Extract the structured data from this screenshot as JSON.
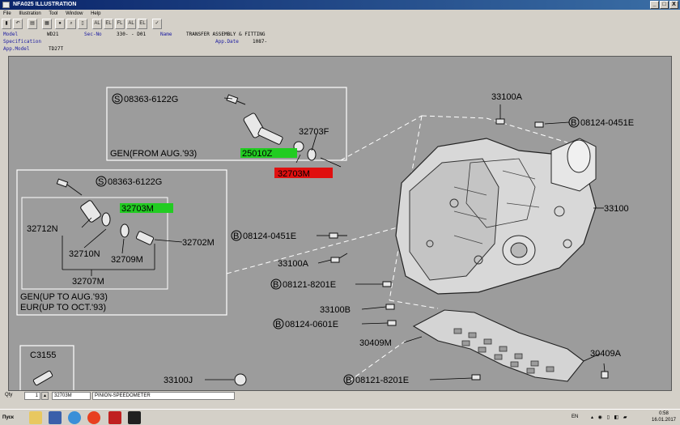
{
  "window": {
    "title": "NFA025 ILLUSTRATION",
    "min": "_",
    "max": "□",
    "close": "X"
  },
  "menu": [
    "File",
    "Illustration",
    "Tool",
    "Window",
    "Help"
  ],
  "toolbar": {
    "buttons": [
      "book-icon",
      "undo-icon",
      "print-icon",
      "save-icon",
      "circle-icon",
      "search-icon",
      "page-icon",
      "AL",
      "EL",
      "FL",
      "AL",
      "EL",
      "check-icon"
    ]
  },
  "info": {
    "model_label": "Model",
    "model": "WD21",
    "secno_label": "Sec-No",
    "secno": "330-  - D01",
    "name_label": "Name",
    "name": "TRANSFER ASSEMBLY & FITTING",
    "spec_label": "Specification",
    "appdate_label": "App.Date",
    "appdate": "1087-",
    "appmodel_label": "App.Model",
    "appmodel": "TD27T"
  },
  "diagram": {
    "labels": {
      "b1": "08363-6122G",
      "b1_prefix": "S",
      "p32703F": "32703F",
      "gen_aug93": "GEN(FROM AUG.'93)",
      "hl_25010Z": "25010Z",
      "hl_32703M_red": "32703M",
      "b2": "08363-6122G",
      "b2_prefix": "S",
      "hl_32703M_green": "32703M",
      "p32712N": "32712N",
      "p32702M": "32702M",
      "p32710N": "32710N",
      "p32709M": "32709M",
      "p32707M": "32707M",
      "gen_up_aug93": "GEN(UP TO AUG.'93)",
      "eur_up_oct93": "EUR(UP TO OCT.'93)",
      "c3155": "C3155",
      "p33100A_top": "33100A",
      "b3": "08124-0451E",
      "b3_prefix": "B",
      "p33100": "33100",
      "b4": "08124-0451E",
      "b4_prefix": "B",
      "p33100A_mid": "33100A",
      "b5": "08121-8201E",
      "b5_prefix": "B",
      "p33100B": "33100B",
      "b6": "08124-0601E",
      "b6_prefix": "B",
      "p30409M": "30409M",
      "p30409A": "30409A",
      "b7": "08121-8201E",
      "b7_prefix": "B",
      "p33100J": "33100J"
    },
    "colors": {
      "bg": "#9c9c9c",
      "green": "#22cc22",
      "red": "#e01010",
      "line": "#000000"
    }
  },
  "status": {
    "qty_label": "Qty",
    "qty": "1",
    "part": "32703M",
    "desc": "PINION-SPEEDOMETER"
  },
  "taskbar": {
    "start": "Пуск",
    "lang": "EN",
    "time": "0:58",
    "date": "16.01.2017"
  }
}
